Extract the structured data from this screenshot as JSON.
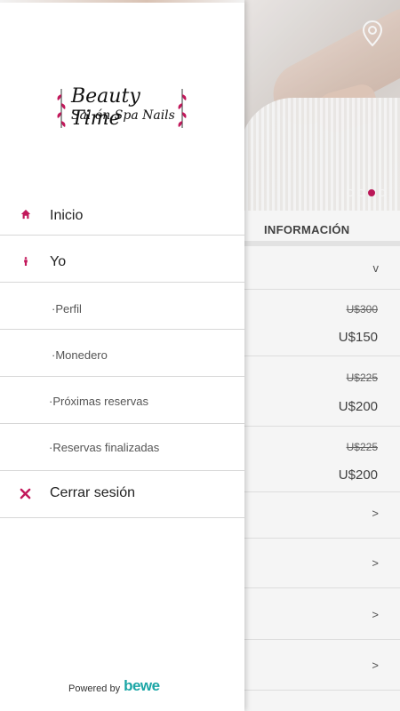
{
  "drawer": {
    "logo": {
      "line1": "Beauty Time",
      "line2": "Sal ón Spa Nails"
    },
    "menu": [
      {
        "label": "Inicio",
        "icon": "home-icon"
      },
      {
        "label": "Yo",
        "icon": "person-icon"
      },
      {
        "label": "·Perfil"
      },
      {
        "label": "·Monedero"
      },
      {
        "label": "·Próximas reservas"
      },
      {
        "label": "·Reservas finalizadas"
      },
      {
        "label": "Cerrar sesión",
        "icon": "close-icon"
      }
    ],
    "powered": {
      "text": "Powered by",
      "brand": "bewe"
    }
  },
  "background": {
    "section_title": "INFORMACIÓN",
    "expand_chevron": "v",
    "prices": [
      {
        "old": "U$300",
        "new": "U$150"
      },
      {
        "old": "U$225",
        "new": "U$200"
      },
      {
        "old": "U$225",
        "new": "U$200"
      }
    ],
    "row_chevron": ">"
  },
  "colors": {
    "accent": "#c2185b",
    "brand": "#1ba6a6"
  }
}
